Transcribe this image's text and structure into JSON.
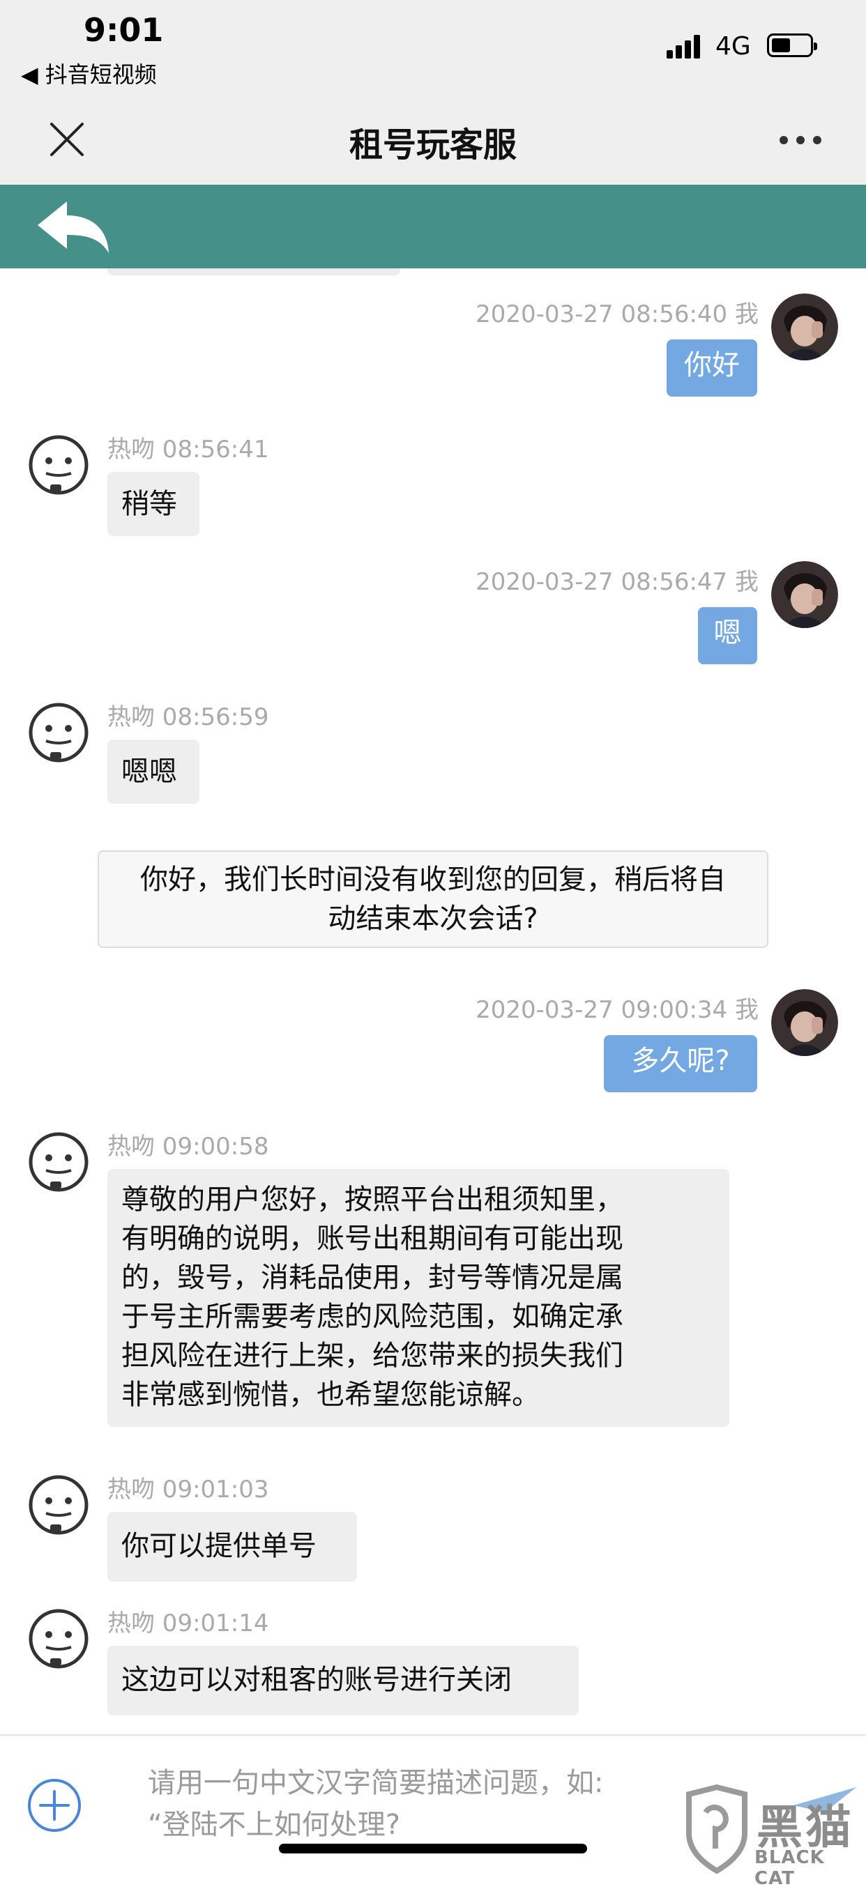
{
  "status_bar": {
    "time": "9:01",
    "back_app": "◀ 抖音短视频",
    "network": "4G"
  },
  "header": {
    "title": "租号玩客服"
  },
  "colors": {
    "accent_green": "#45918a",
    "user_bubble": "#73a8e3",
    "agent_bubble": "#eeeeee"
  },
  "messages": [
    {
      "sender": "user",
      "meta": "2020-03-27 08:56:40  我",
      "text": "你好"
    },
    {
      "sender": "agent",
      "meta": "热吻  08:56:41",
      "text": "稍等"
    },
    {
      "sender": "user",
      "meta": "2020-03-27 08:56:47  我",
      "text": "嗯"
    },
    {
      "sender": "agent",
      "meta": "热吻  08:56:59",
      "text": "嗯嗯"
    },
    {
      "sender": "system",
      "line1": "你好，我们长时间没有收到您的回复，稍后将自",
      "line2": "动结束本次会话?"
    },
    {
      "sender": "user",
      "meta": "2020-03-27 09:00:34  我",
      "text": "多久呢?"
    },
    {
      "sender": "agent",
      "meta": "热吻  09:00:58",
      "lines": [
        "尊敬的用户您好，按照平台出租须知里，",
        "有明确的说明，账号出租期间有可能出现",
        "的，毁号，消耗品使用，封号等情况是属",
        "于号主所需要考虑的风险范围，如确定承",
        "担风险在进行上架，给您带来的损失我们",
        "非常感到惋惜，也希望您能谅解。"
      ]
    },
    {
      "sender": "agent",
      "meta": "热吻  09:01:03",
      "text": "你可以提供单号"
    },
    {
      "sender": "agent",
      "meta": "热吻  09:01:14",
      "text": "这边可以对租客的账号进行关闭"
    }
  ],
  "input": {
    "placeholder_line1": "请用一句中文汉字简要描述问题，如:",
    "placeholder_line2": "“登陆不上如何处理?"
  },
  "watermark": {
    "text": "黑猫",
    "sub": "BLACK CAT"
  }
}
